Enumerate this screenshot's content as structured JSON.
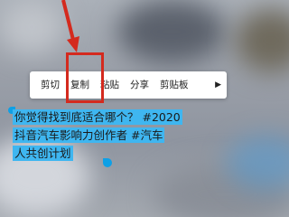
{
  "context_menu": {
    "items": [
      {
        "label": "剪切"
      },
      {
        "label": "复制"
      },
      {
        "label": "粘贴"
      },
      {
        "label": "分享"
      },
      {
        "label": "剪贴板"
      }
    ],
    "more_icon": "play-right-icon"
  },
  "selection": {
    "lines": [
      "你觉得找到底适合哪个？  #2020",
      "抖音汽车影响力创作者    #汽车",
      "人共创计划"
    ]
  },
  "annotation": {
    "arrow_color": "#d42a1e",
    "highlight_color": "#d42a1e"
  }
}
